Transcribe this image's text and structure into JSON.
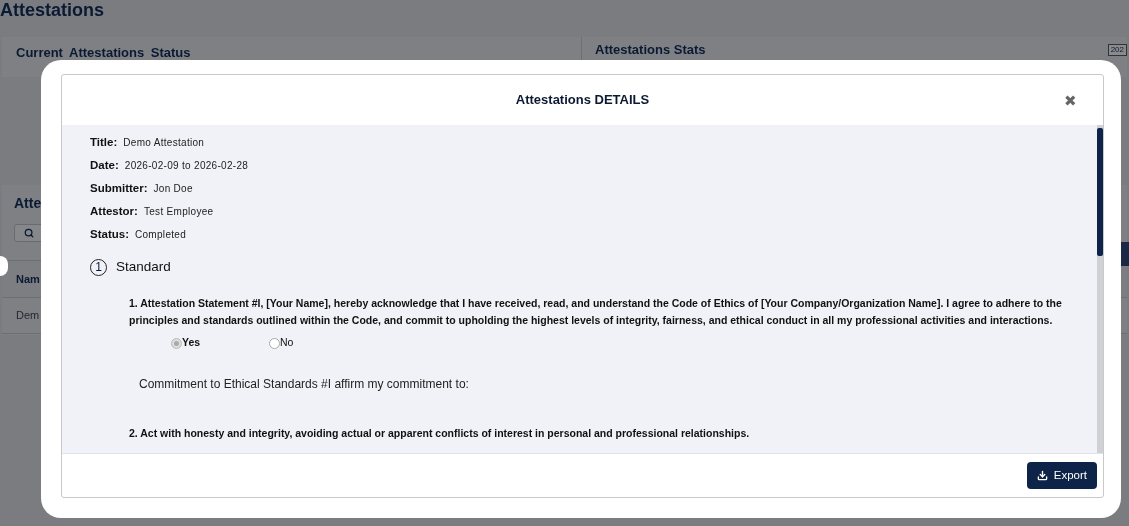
{
  "page": {
    "title": "Attestations",
    "status_panel": {
      "title": "Current Attestations Status"
    },
    "stats_panel": {
      "title": "Attestations Stats",
      "badge": "202"
    },
    "list_panel": {
      "title": "Atte",
      "columns": [
        "Nam"
      ],
      "rows": [
        [
          "Dem"
        ]
      ]
    }
  },
  "modal": {
    "title": "Attestations DETAILS",
    "close": "✖",
    "fields": [
      {
        "label": "Title:",
        "value": "Demo Attestation"
      },
      {
        "label": "Date:",
        "value": "2026-02-09 to 2026-02-28"
      },
      {
        "label": "Submitter:",
        "value": "Jon Doe"
      },
      {
        "label": "Attestor:",
        "value": "Test Employee"
      },
      {
        "label": "Status:",
        "value": "Completed"
      }
    ],
    "section": {
      "number": "1",
      "title": "Standard"
    },
    "items": [
      {
        "kind": "question",
        "text": "1. Attestation Statement #I, [Your Name], hereby acknowledge that I have received, read, and understand the Code of Ethics of [Your Company/Organization Name]. I agree to adhere to the principles and standards outlined within the Code, and commit to upholding the highest levels of integrity, fairness, and ethical conduct in all my professional activities and interactions.",
        "options": [
          {
            "label": "Yes",
            "selected": true
          },
          {
            "label": "No",
            "selected": false
          }
        ]
      },
      {
        "kind": "note",
        "text": "Commitment to Ethical Standards #I affirm my commitment to:"
      },
      {
        "kind": "question",
        "text": "2. Act with honesty and integrity, avoiding actual or apparent conflicts of interest in personal and professional relationships."
      }
    ],
    "export_button": "Export"
  }
}
